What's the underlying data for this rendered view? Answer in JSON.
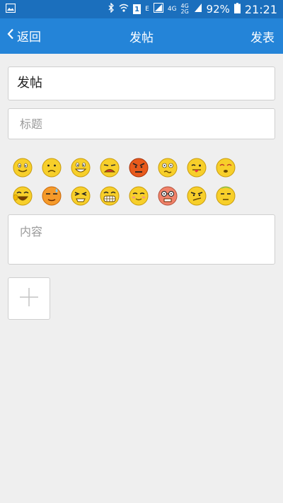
{
  "status_bar": {
    "network_e": "E",
    "network_4g_top": "4G",
    "network_4g_stack": "4G 2G",
    "battery": "92%",
    "time": "21:21",
    "sim_number": "1"
  },
  "nav": {
    "back_label": "返回",
    "title": "发帖",
    "action_label": "发表"
  },
  "form": {
    "board_name": "发帖",
    "title_placeholder": "标题",
    "content_placeholder": "内容"
  },
  "emojis": [
    {
      "name": "smile-emoji"
    },
    {
      "name": "sad-emoji"
    },
    {
      "name": "grin-emoji"
    },
    {
      "name": "upset-emoji"
    },
    {
      "name": "angry-emoji"
    },
    {
      "name": "confused-emoji"
    },
    {
      "name": "tongue-emoji"
    },
    {
      "name": "sleepy-emoji"
    },
    {
      "name": "laugh-emoji"
    },
    {
      "name": "sweat-emoji"
    },
    {
      "name": "squint-emoji"
    },
    {
      "name": "big-grin-emoji"
    },
    {
      "name": "blush-emoji"
    },
    {
      "name": "nerd-emoji"
    },
    {
      "name": "smirk-emoji"
    },
    {
      "name": "annoyed-emoji"
    }
  ],
  "colors": {
    "status_bar": "#1b6fbd",
    "nav_bar": "#2484d8",
    "background": "#efefef"
  }
}
